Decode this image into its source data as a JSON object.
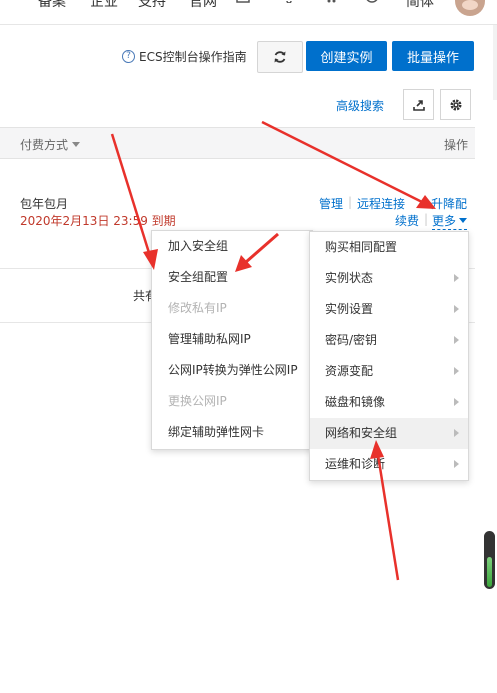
{
  "topnav": {
    "items": [
      "",
      "备案",
      "企业",
      "支持",
      "官网",
      "",
      "",
      "",
      "",
      "简体"
    ]
  },
  "toolbar": {
    "guide_label": "ECS控制台操作指南",
    "create_label": "创建实例",
    "batch_label": "批量操作",
    "advanced_search_label": "高级搜索"
  },
  "table": {
    "header_pay": "付费方式",
    "header_op": "操作",
    "row": {
      "pay_type": "包年包月",
      "expire": "2020年2月13日 23:59 到期",
      "actions": {
        "manage": "管理",
        "remote": "远程连接",
        "upgrade": "升降配",
        "renew": "续费",
        "more": "更多"
      }
    },
    "total": "共有"
  },
  "submenu": {
    "items": [
      {
        "label": "加入安全组",
        "disabled": false
      },
      {
        "label": "安全组配置",
        "disabled": false
      },
      {
        "label": "修改私有IP",
        "disabled": true
      },
      {
        "label": "管理辅助私网IP",
        "disabled": false
      },
      {
        "label": "公网IP转换为弹性公网IP",
        "disabled": false
      },
      {
        "label": "更换公网IP",
        "disabled": true
      },
      {
        "label": "绑定辅助弹性网卡",
        "disabled": false
      }
    ]
  },
  "mainmenu": {
    "items": [
      {
        "label": "购买相同配置",
        "has_sub": false
      },
      {
        "label": "实例状态",
        "has_sub": true
      },
      {
        "label": "实例设置",
        "has_sub": true
      },
      {
        "label": "密码/密钥",
        "has_sub": true
      },
      {
        "label": "资源变配",
        "has_sub": true
      },
      {
        "label": "磁盘和镜像",
        "has_sub": true
      },
      {
        "label": "网络和安全组",
        "has_sub": true,
        "active": true
      },
      {
        "label": "运维和诊断",
        "has_sub": true
      }
    ]
  },
  "colors": {
    "primary": "#0070cc",
    "annotation_arrow": "#e8312b",
    "expire_text": "#c0392b"
  }
}
